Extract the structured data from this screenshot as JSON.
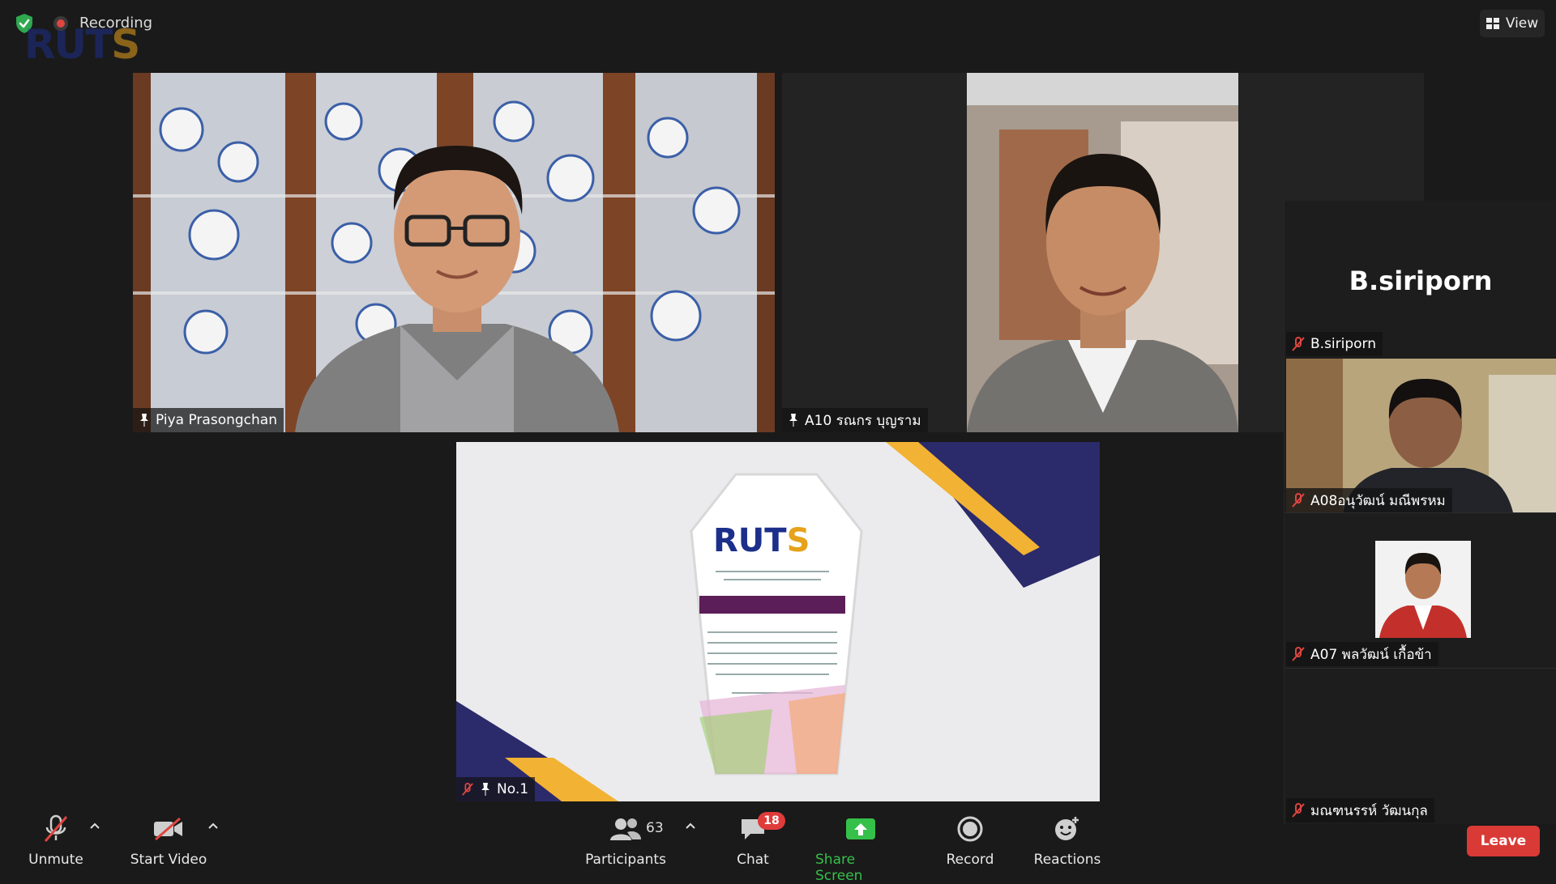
{
  "top_bar": {
    "recording_label": "Recording",
    "view_label": "View",
    "logo_text_part1": "RUT",
    "logo_text_part2": "S"
  },
  "tiles": [
    {
      "id": "piya",
      "name": "Piya Prasongchan",
      "pinned": true,
      "muted": false
    },
    {
      "id": "a10",
      "name": "A10 รณกร บุญราม",
      "pinned": true,
      "muted": false
    },
    {
      "id": "no1",
      "name": "No.1",
      "pinned": true,
      "muted": true
    }
  ],
  "side_panel": {
    "bsiriporn_display": "B.siriporn",
    "participants": [
      {
        "name": "B.siriporn",
        "muted": true,
        "video": false
      },
      {
        "name": "A08อนุวัฒน์ มณีพรหม",
        "muted": true,
        "video": true
      },
      {
        "name": "A07 พลวัฒน์ เกื้อข้า",
        "muted": true,
        "video": true
      },
      {
        "name": "มณฑนรรห์ วัฒนกุล",
        "muted": true,
        "video": false
      }
    ]
  },
  "slide": {
    "logo_part1": "RUT",
    "logo_part2": "S"
  },
  "toolbar": {
    "unmute": "Unmute",
    "start_video": "Start Video",
    "participants": "Participants",
    "participants_count": "63",
    "chat": "Chat",
    "chat_badge": "18",
    "share_screen": "Share Screen",
    "record": "Record",
    "reactions": "Reactions",
    "leave": "Leave"
  },
  "colors": {
    "background": "#1a1a1a",
    "share_green": "#35c04a",
    "leave_red": "#d93a35",
    "badge_red": "#e03b3b",
    "mute_red": "#e0453f",
    "ruts_blue": "#1c2f8a",
    "ruts_orange": "#e6a21a"
  }
}
